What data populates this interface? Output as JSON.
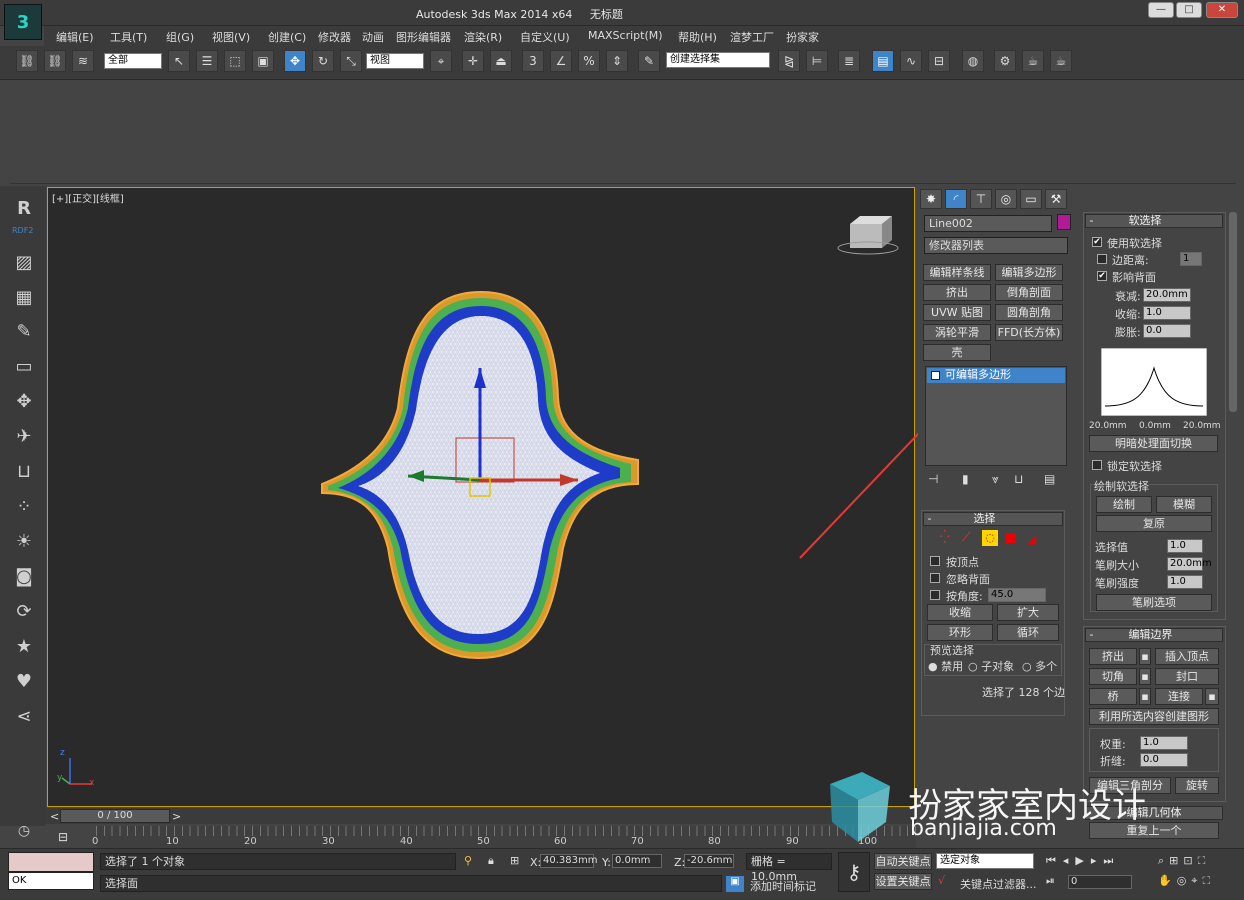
{
  "app": {
    "title": "Autodesk 3ds Max  2014 x64",
    "doc": "无标题",
    "logo_icon": "3dsmax-logo-icon"
  },
  "window_buttons": [
    "—",
    "□",
    "✕"
  ],
  "menu": [
    "编辑(E)",
    "工具(T)",
    "组(G)",
    "视图(V)",
    "创建(C)",
    "修改器",
    "动画",
    "图形编辑器",
    "渲染(R)",
    "自定义(U)",
    "MAXScript(M)",
    "帮助(H)",
    "渲梦工厂",
    "扮家家"
  ],
  "toolbar": {
    "filter": "全部",
    "view": "视图",
    "selection_set": "创建选择集"
  },
  "sidebar": {
    "rdf_label": "RDF2"
  },
  "viewport": {
    "label": "[+][正交][线框]",
    "axis": {
      "x": "x",
      "y": "y",
      "z": "z"
    }
  },
  "panel": {
    "object_name": "Line002",
    "modifier_list": "修改器列表",
    "mod_buttons": [
      "编辑样条线",
      "编辑多边形",
      "挤出",
      "倒角剖面",
      "UVW 贴图",
      "圆角剖角",
      "涡轮平滑",
      "FFD(长方体)",
      "壳"
    ],
    "stack_item": "可编辑多边形",
    "selection": {
      "title": "选择",
      "by_vertex": "按顶点",
      "ignore_back": "忽略背面",
      "by_angle": "按角度:",
      "angle_val": "45.0",
      "shrink": "收缩",
      "grow": "扩大",
      "ring": "环形",
      "loop": "循环",
      "preview": "预览选择",
      "disable": "禁用",
      "subobj": "子对象",
      "multi": "多个",
      "status": "选择了 128 个边"
    },
    "soft": {
      "title": "软选择",
      "use_soft": "使用软选择",
      "edge_dist": "边距离:",
      "edge_val": "1",
      "affect_back": "影响背面",
      "falloff": "衰减:",
      "falloff_val": "20.0mm",
      "pinch": "收缩:",
      "pinch_val": "1.0",
      "bubble": "膨胀:",
      "bubble_val": "0.0",
      "curve_left": "20.0mm",
      "curve_mid": "0.0mm",
      "curve_right": "20.0mm",
      "shade_face": "明暗处理面切换",
      "lock_soft": "锁定软选择",
      "paint_soft": "绘制软选择",
      "paint": "绘制",
      "blur": "模糊",
      "revert": "复原",
      "sel_value": "选择值",
      "sel_value_v": "1.0",
      "brush_size": "笔刷大小",
      "brush_size_v": "20.0mm",
      "brush_strength": "笔刷强度",
      "brush_strength_v": "1.0",
      "brush_opts": "笔刷选项"
    },
    "edit_border": {
      "title": "编辑边界",
      "extrude": "挤出",
      "insert_vertex": "插入顶点",
      "chamfer": "切角",
      "cap": "封口",
      "bridge": "桥",
      "connect": "连接",
      "create_shape": "利用所选内容创建图形",
      "weight": "权重:",
      "weight_v": "1.0",
      "crease": "折缝:",
      "crease_v": "0.0",
      "edit_tri": "编辑三角剖分",
      "rotate": "旋转"
    },
    "edit_geom": {
      "title": "编辑几何体",
      "repeat": "重复上一个"
    }
  },
  "timeline": {
    "frame": "0 / 100",
    "ticks": [
      "0",
      "10",
      "20",
      "30",
      "40",
      "50",
      "60",
      "70",
      "80",
      "90",
      "100"
    ]
  },
  "status": {
    "line1": "选择了 1 个对象",
    "line2": "选择面",
    "x_label": "X:",
    "x": "40.383mm",
    "y_label": "Y:",
    "y": "0.0mm",
    "z_label": "Z:",
    "z": "-20.6mm",
    "grid": "栅格 = 10.0mm",
    "auto_key": "自动关键点",
    "set_key": "设置关键点",
    "sel_obj": "选定对象",
    "key_filter": "关键点过滤器...",
    "add_time_tag": "添加时间标记",
    "frame_field": "0",
    "ok": "OK"
  },
  "watermark": {
    "name": "扮家家室内设计",
    "url": "banjiajia.com"
  },
  "colors": {
    "accent": "#3f84c8",
    "viewport_border": "#c9a000",
    "arrow": "#e53935",
    "watermark_teal": "#3fb8c9"
  }
}
